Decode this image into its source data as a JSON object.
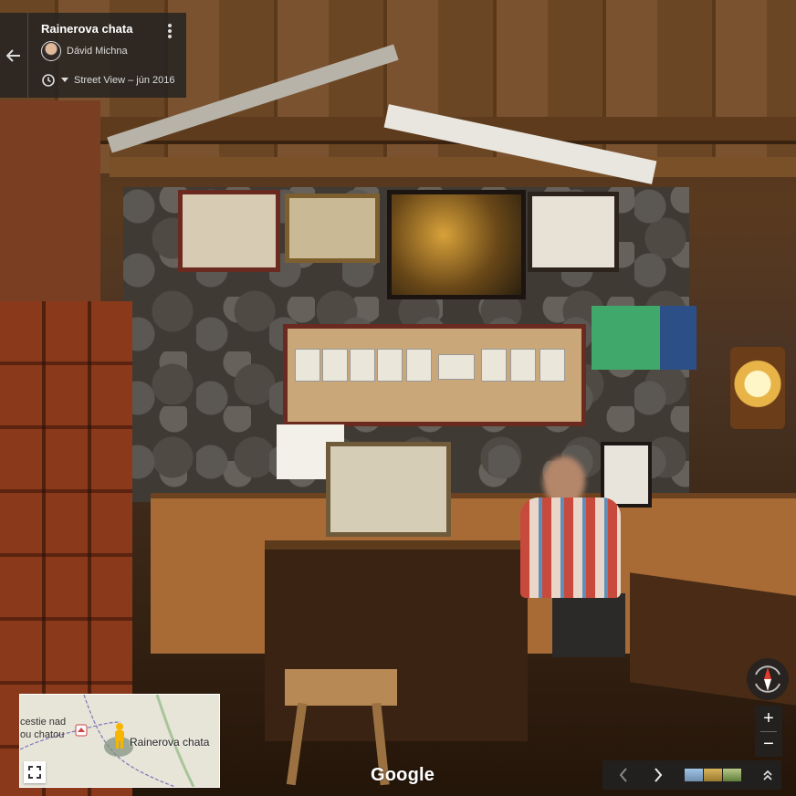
{
  "header": {
    "title": "Rainerova chata",
    "author": "Dávid Michna",
    "date": "Street View – jún 2016",
    "back_icon": "arrow-left-icon",
    "more_icon": "more-vert-icon",
    "history_icon": "history-clock-icon"
  },
  "minimap": {
    "place_label": "Rainerova chata",
    "crossroad_label_line1": "cestie nad",
    "crossroad_label_line2": "ou chatou",
    "expand_icon": "fullscreen-icon"
  },
  "footer": {
    "logo": "Google"
  },
  "controls": {
    "zoom_in_label": "+",
    "zoom_out_label": "−",
    "prev_icon": "chevron-left-icon",
    "next_icon": "chevron-right-icon",
    "expand_up_icon": "double-chevron-up-icon"
  },
  "colors": {
    "overlay_bg": "#222222",
    "compass_red": "#e33b2e"
  }
}
